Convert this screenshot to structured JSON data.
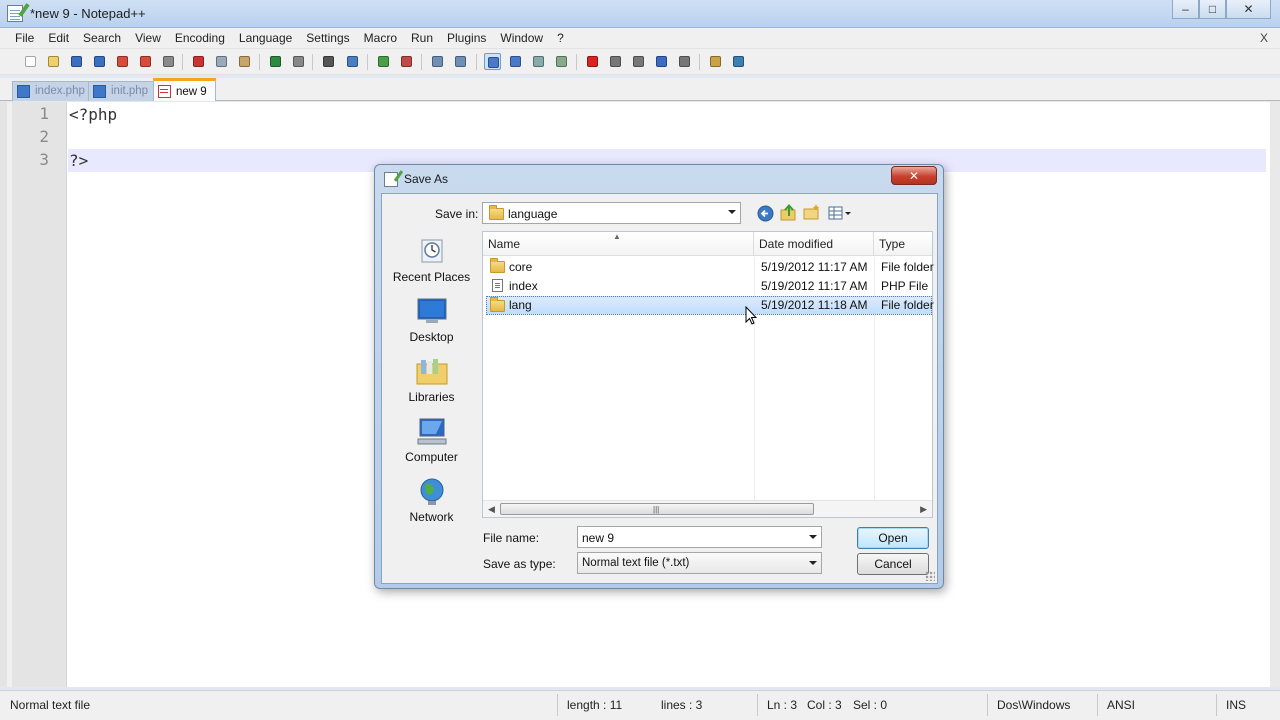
{
  "window": {
    "title": "*new  9 - Notepad++",
    "controls": {
      "minimize": "–",
      "maximize": "□",
      "close": "✕"
    }
  },
  "menubar": {
    "items": [
      "File",
      "Edit",
      "Search",
      "View",
      "Encoding",
      "Language",
      "Settings",
      "Macro",
      "Run",
      "Plugins",
      "Window",
      "?"
    ],
    "close": "X"
  },
  "toolbar": {
    "icons": [
      "new-file-icon",
      "open-file-icon",
      "save-icon",
      "save-all-icon",
      "close-icon",
      "close-all-icon",
      "print-icon",
      "cut-icon",
      "copy-icon",
      "paste-icon",
      "undo-icon",
      "redo-icon",
      "find-icon",
      "replace-icon",
      "zoom-in-icon",
      "zoom-out-icon",
      "sync-vertical-icon",
      "sync-horizontal-icon",
      "word-wrap-icon",
      "show-all-chars-icon",
      "indent-guide-icon",
      "user-lang-icon",
      "record-macro-icon",
      "stop-macro-icon",
      "play-macro-icon",
      "run-macro-multiple-icon",
      "save-macro-icon",
      "launch-browser-icon",
      "spellcheck-icon"
    ]
  },
  "tabs": [
    {
      "label": "index.php",
      "active": false
    },
    {
      "label": "init.php",
      "active": false
    },
    {
      "label": "new  9",
      "active": true
    }
  ],
  "editor": {
    "lines": [
      {
        "num": "1",
        "text": "<?php"
      },
      {
        "num": "2",
        "text": ""
      },
      {
        "num": "3",
        "text": "?>"
      }
    ],
    "current_line": 3
  },
  "statusbar": {
    "file_type": "Normal text file",
    "length": "length : 11",
    "lines": "lines : 3",
    "ln": "Ln : 3",
    "col": "Col : 3",
    "sel": "Sel : 0",
    "eol": "Dos\\Windows",
    "encoding": "ANSI",
    "mode": "INS"
  },
  "dialog": {
    "title": "Save As",
    "close": "✕",
    "save_in_label": "Save in:",
    "save_in_value": "language",
    "places": [
      "Recent Places",
      "Desktop",
      "Libraries",
      "Computer",
      "Network"
    ],
    "columns": [
      "Name",
      "Date modified",
      "Type"
    ],
    "files": [
      {
        "name": "core",
        "date": "5/19/2012 11:17 AM",
        "type": "File folder",
        "kind": "folder",
        "selected": false
      },
      {
        "name": "index",
        "date": "5/19/2012 11:17 AM",
        "type": "PHP File",
        "kind": "file",
        "selected": false
      },
      {
        "name": "lang",
        "date": "5/19/2012 11:18 AM",
        "type": "File folder",
        "kind": "folder",
        "selected": true
      }
    ],
    "file_name_label": "File name:",
    "file_name_value": "new  9",
    "save_type_label": "Save as type:",
    "save_type_value": "Normal text file (*.txt)",
    "open_button": "Open",
    "cancel_button": "Cancel"
  },
  "colors": {
    "current_line": "#e8e8ff",
    "active_tab_accent": "#f6a521",
    "selection": "#c1dcfc",
    "dialog_frame": "#b3cbe8"
  }
}
